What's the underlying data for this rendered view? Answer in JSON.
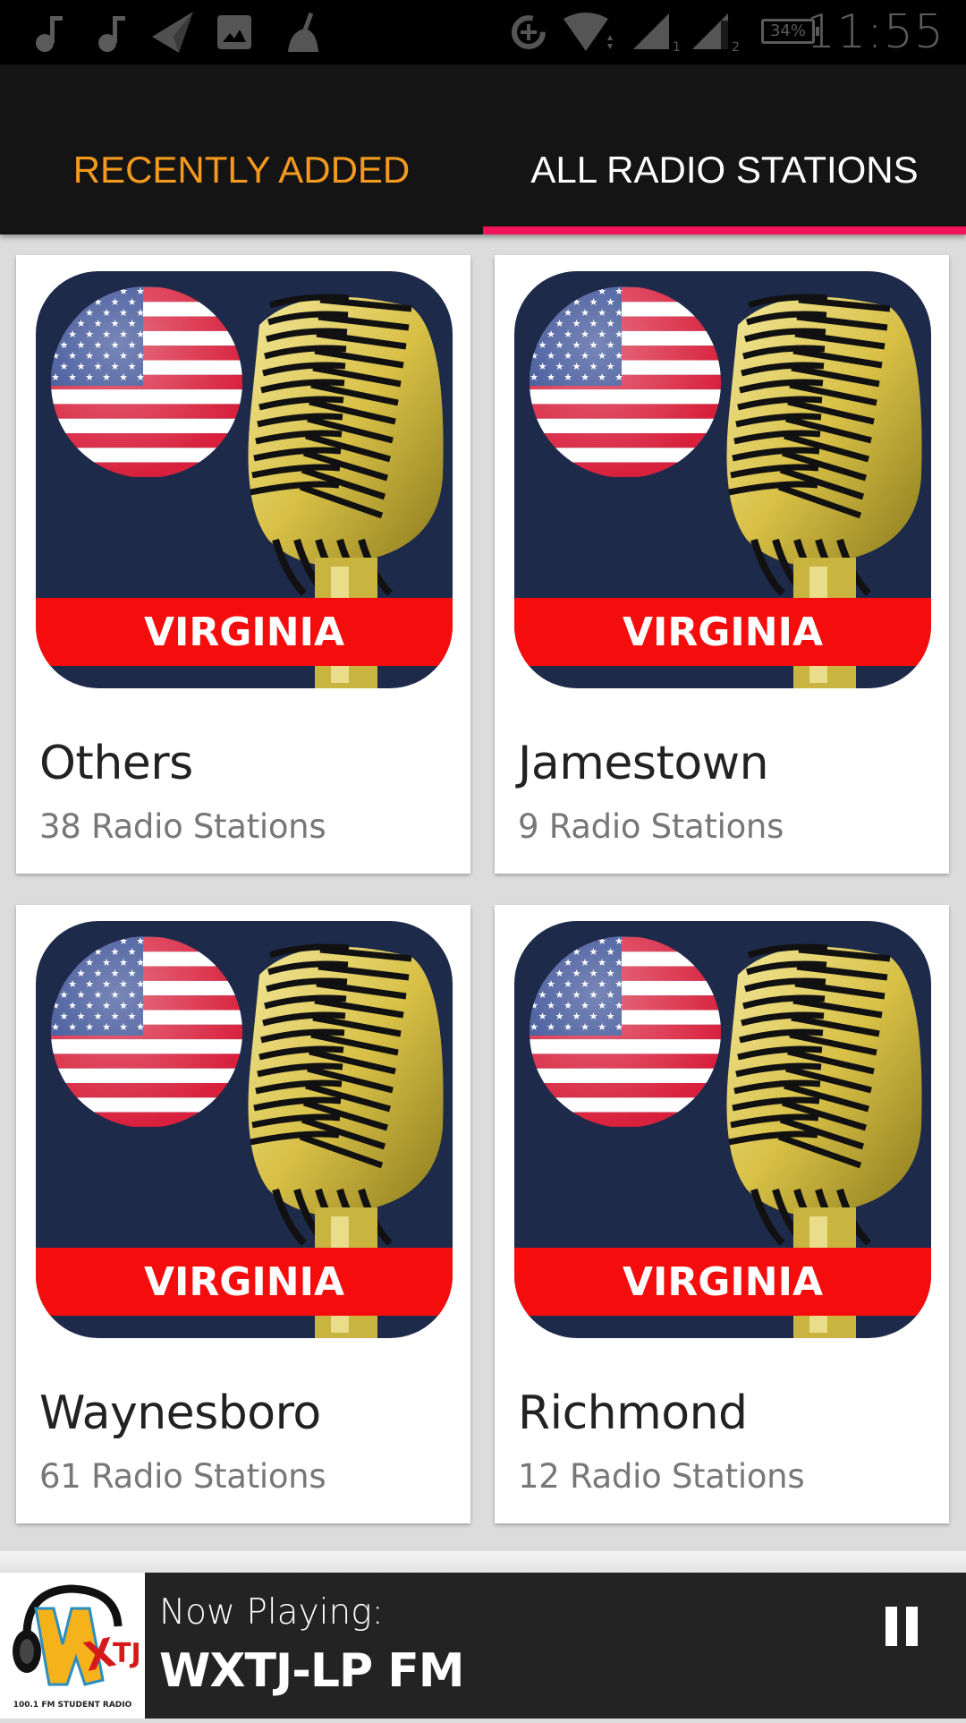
{
  "status_bar": {
    "left_icons": [
      "music-note-icon",
      "music-note-icon",
      "navigation-arrow-icon",
      "image-icon",
      "cleaner-broom-icon"
    ],
    "right_icons": [
      "data-saver-icon",
      "wifi-icon",
      "signal-sim1-icon",
      "signal-sim2-icon"
    ],
    "sim1_label": "1",
    "sim2_label": "2",
    "battery": "34%",
    "time": "11:55"
  },
  "tabs": [
    {
      "label": "RECENTLY ADDED",
      "selected": false
    },
    {
      "label": "ALL RADIO STATIONS",
      "selected": true
    }
  ],
  "colors": {
    "accent_tab_text": "#f39a1c",
    "tab_indicator": "#f0145a",
    "tabbar_bg": "#141414",
    "player_bg": "#232323",
    "banner_red": "#f50d0d",
    "icon_navy": "#1e2a4a"
  },
  "cards": [
    {
      "title": "Others",
      "subtitle": "38 Radio Stations",
      "banner": "VIRGINIA"
    },
    {
      "title": "Jamestown",
      "subtitle": "9 Radio Stations",
      "banner": "VIRGINIA"
    },
    {
      "title": "Waynesboro",
      "subtitle": "61 Radio Stations",
      "banner": "VIRGINIA"
    },
    {
      "title": "Richmond",
      "subtitle": "12 Radio Stations",
      "banner": "VIRGINIA"
    }
  ],
  "player": {
    "label": "Now Playing:",
    "station": "WXTJ-LP FM",
    "logo_text": "100.1 FM STUDENT RADIO",
    "logo_letters": "WXTJ",
    "control": "pause-icon"
  }
}
